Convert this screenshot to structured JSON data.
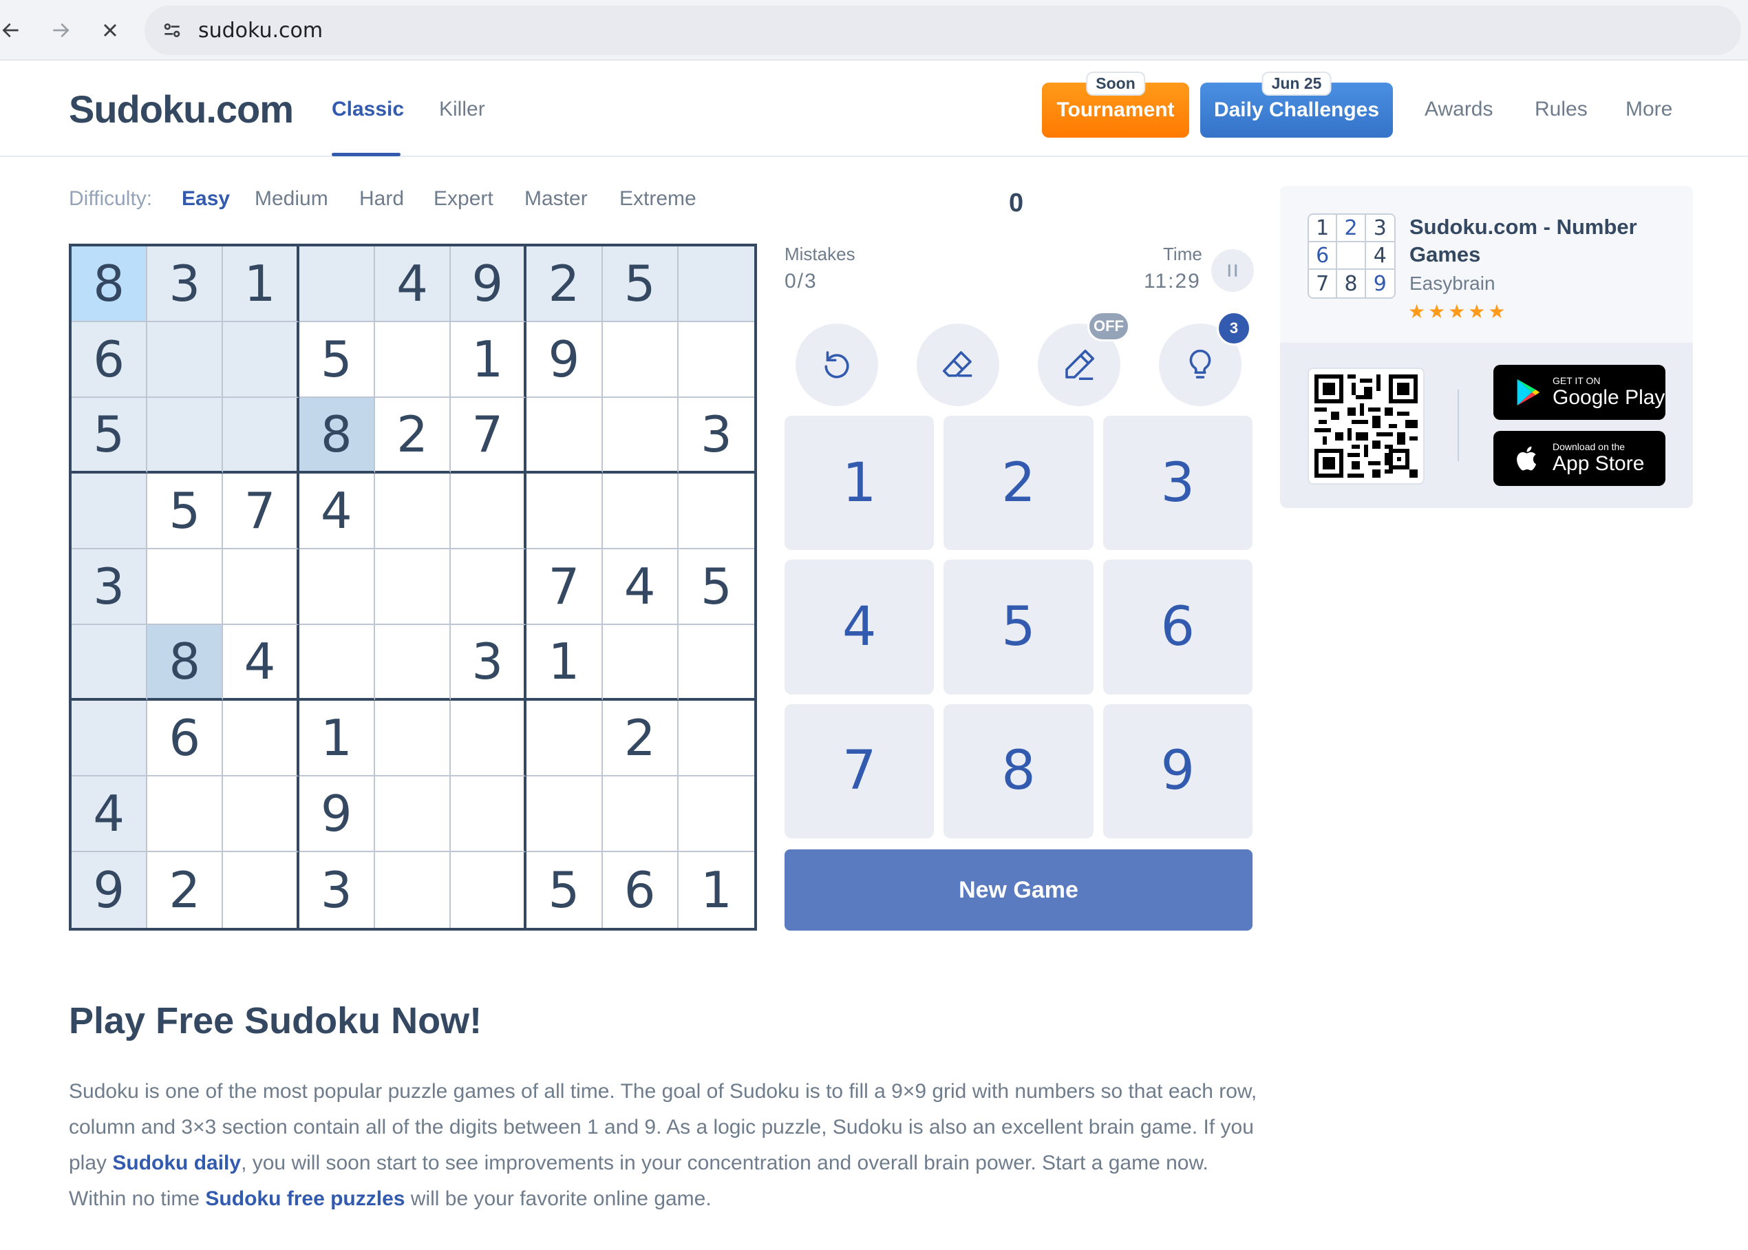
{
  "browser": {
    "url": "sudoku.com"
  },
  "header": {
    "logo": "Sudoku.com",
    "tabs": [
      {
        "label": "Classic",
        "active": true
      },
      {
        "label": "Killer",
        "active": false
      }
    ],
    "tournament": {
      "label": "Tournament",
      "badge": "Soon"
    },
    "daily": {
      "label": "Daily Challenges",
      "badge": "Jun 25"
    },
    "links": [
      "Awards",
      "Rules",
      "More"
    ]
  },
  "difficulty": {
    "label": "Difficulty:",
    "levels": [
      "Easy",
      "Medium",
      "Hard",
      "Expert",
      "Master",
      "Extreme"
    ],
    "selected": "Easy"
  },
  "score": "0",
  "game": {
    "mistakes_label": "Mistakes",
    "mistakes": "0/3",
    "time_label": "Time",
    "time": "11:29",
    "tools": [
      {
        "name": "undo",
        "icon": "undo-icon"
      },
      {
        "name": "erase",
        "icon": "eraser-icon"
      },
      {
        "name": "notes",
        "icon": "pencil-icon",
        "badge": "OFF"
      },
      {
        "name": "hint",
        "icon": "lightbulb-icon",
        "badge": "3"
      }
    ],
    "numpad": [
      "1",
      "2",
      "3",
      "4",
      "5",
      "6",
      "7",
      "8",
      "9"
    ],
    "new_game": "New Game",
    "board": [
      [
        "8",
        "3",
        "1",
        "",
        "4",
        "9",
        "2",
        "5",
        ""
      ],
      [
        "6",
        "",
        "",
        "5",
        "",
        "1",
        "9",
        "",
        ""
      ],
      [
        "5",
        "",
        "",
        "8",
        "2",
        "7",
        "",
        "",
        "3"
      ],
      [
        "",
        "5",
        "7",
        "4",
        "",
        "",
        "",
        "",
        ""
      ],
      [
        "3",
        "",
        "",
        "",
        "",
        "",
        "7",
        "4",
        "5"
      ],
      [
        "",
        "8",
        "4",
        "",
        "",
        "3",
        "1",
        "",
        ""
      ],
      [
        "",
        "6",
        "",
        "1",
        "",
        "",
        "",
        "2",
        ""
      ],
      [
        "4",
        "",
        "",
        "9",
        "",
        "",
        "",
        "",
        ""
      ],
      [
        "9",
        "2",
        "",
        "3",
        "",
        "",
        "5",
        "6",
        "1"
      ]
    ],
    "selected_cell": [
      0,
      0
    ]
  },
  "app_card": {
    "icon_digits": [
      "1",
      "2",
      "3",
      "6",
      "",
      "4",
      "7",
      "8",
      "9"
    ],
    "title": "Sudoku.com - Number Games",
    "developer": "Easybrain",
    "rating": 4.5,
    "stars": "★★★★★",
    "google_play": {
      "small": "GET IT ON",
      "big": "Google Play"
    },
    "app_store": {
      "small": "Download on the",
      "big": "App Store"
    }
  },
  "content": {
    "heading": "Play Free Sudoku Now!",
    "p1": "Sudoku is one of the most popular puzzle games of all time. The goal of Sudoku is to fill a 9×9 grid with numbers so that each row, column and 3×3 section contain all of the digits between 1 and 9. As a logic puzzle, Sudoku is also an excellent brain game. If you play ",
    "link1": "Sudoku daily",
    "p2": ", you will soon start to see improvements in your concentration and overall brain power. Start a game now. Within no time ",
    "link2": "Sudoku free puzzles",
    "p3": " will be your favorite online game."
  },
  "colors": {
    "accent": "#325aaf",
    "text": "#344861",
    "muted": "#6e7c8c",
    "tournament": "#ff8a00",
    "daily": "#3f82d6",
    "new_game": "#5a7bc0"
  }
}
